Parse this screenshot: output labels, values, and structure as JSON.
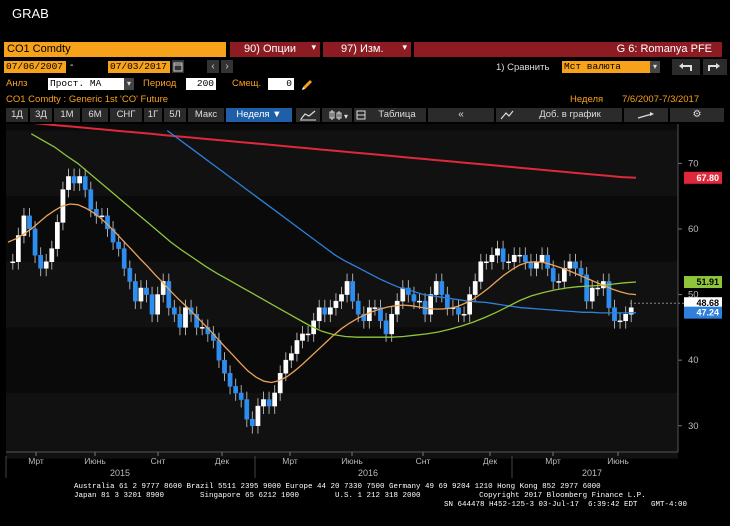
{
  "window": {
    "title": "GRAB"
  },
  "header": {
    "security": "CO1 Comdty",
    "options_menu": "90) Опции",
    "edit_menu": "97) Изм.",
    "page_label": "G 6: Romanya PFE"
  },
  "controls": {
    "date_from": "07/06/2007",
    "date_sep": "-",
    "date_to": "07/03/2017",
    "compare_label": "1) Сравнить",
    "currency_value": "Мст валюта",
    "study_label": "Анлз",
    "study_value": "Прост. MA",
    "period_label": "Период",
    "period_value": "200",
    "shift_label": "Смещ.",
    "shift_value": "0"
  },
  "subheader": {
    "description": "CO1 Comdty : Generic 1st 'CO' Future",
    "frequency": "Неделя",
    "range": "7/6/2007-7/3/2017"
  },
  "toolbar": {
    "periods": [
      "1Д",
      "3Д",
      "1М",
      "6М",
      "СНГ",
      "1Г",
      "5Л",
      "Макс"
    ],
    "frequency_select": "Неделя ▼",
    "table_label": "Таблица",
    "add_to_chart": "Доб. в график"
  },
  "colors": {
    "amber": "#f7a21b",
    "menu_red": "#8c1b22",
    "ma200": "#e0283c",
    "ma100": "#2f7fdc",
    "ma50": "#8fc53a",
    "ma20": "#e9a35a",
    "candle": "#2d8ef0",
    "price_tag": "#ffffff"
  },
  "chart_data": {
    "type": "candlestick",
    "y_ticks": [
      30,
      40,
      50,
      60,
      70
    ],
    "ylim": [
      26,
      76
    ],
    "x_ticks": [
      "Мрт",
      "Июнь",
      "Снт",
      "Дек",
      "Мрт",
      "Июнь",
      "Снт",
      "Дек",
      "Мрт",
      "Июнь"
    ],
    "year_labels": [
      "2015",
      "2016",
      "2017"
    ],
    "last_values": [
      {
        "label": "67.80",
        "color": "#e0283c"
      },
      {
        "label": "51.91",
        "color": "#8fc53a"
      },
      {
        "label": "48.68",
        "color": "#ffffff"
      },
      {
        "label": "47.24",
        "color": "#2f7fdc"
      }
    ],
    "close": [
      55,
      59,
      62,
      60,
      56,
      54,
      55,
      57,
      61,
      66,
      68,
      67,
      68,
      66,
      63,
      62,
      62,
      60,
      58,
      57,
      54,
      52,
      49,
      51,
      50,
      47,
      50,
      52,
      48,
      47,
      45,
      48,
      47,
      45,
      45,
      44,
      43,
      40,
      38,
      36,
      35,
      34,
      31,
      30,
      33,
      34,
      33,
      35,
      38,
      40,
      41,
      43,
      44,
      44,
      46,
      48,
      47,
      48,
      49,
      50,
      52,
      49,
      47,
      46,
      48,
      48,
      46,
      44,
      47,
      49,
      51,
      50,
      49,
      49,
      47,
      50,
      52,
      50,
      48,
      48,
      47,
      47,
      50,
      52,
      55,
      55,
      56,
      57,
      55,
      55,
      56,
      56,
      55,
      54,
      55,
      56,
      54,
      52,
      52,
      54,
      55,
      54,
      53,
      49,
      51,
      51,
      52,
      48,
      46,
      46,
      47,
      48
    ],
    "ma200": [
      76.5,
      76.3,
      76.1,
      75.9,
      75.7,
      75.5,
      75.3,
      75.1,
      74.9,
      74.7,
      74.5,
      74.3,
      74.1,
      73.9,
      73.7,
      73.5,
      73.3,
      73.1,
      72.9,
      72.7,
      72.5,
      72.3,
      72.1,
      71.9,
      71.7,
      71.5,
      71.3,
      71.1,
      70.9,
      70.7,
      70.5,
      70.3,
      70.1,
      69.9,
      69.7,
      69.5,
      69.3,
      69.1,
      68.9,
      68.7,
      68.5,
      68.3,
      68.1,
      67.9,
      67.8
    ],
    "ma100": [
      null,
      null,
      null,
      null,
      null,
      null,
      null,
      null,
      null,
      null,
      null,
      null,
      null,
      null,
      null,
      null,
      null,
      null,
      75,
      74,
      73,
      72,
      71,
      70,
      69,
      68,
      67,
      66,
      65,
      64,
      63,
      62,
      61,
      60,
      59,
      58,
      57,
      56,
      55.2,
      54.5,
      53.8,
      53.1,
      52.4,
      51.8,
      51.2,
      50.8,
      50.4,
      50,
      49.8,
      49.6,
      49.4,
      49.2,
      49.0,
      48.9,
      48.8,
      48.6,
      48.4,
      48.2,
      48.0,
      47.9,
      47.8,
      47.7,
      47.6,
      47.5,
      47.4,
      47.3,
      47.3,
      47.2,
      47.2,
      47.2,
      47.2,
      47.24
    ],
    "ma50": [
      null,
      null,
      74.5,
      73.5,
      72.5,
      71.2,
      70,
      68.5,
      67,
      65.5,
      64,
      62.5,
      61,
      59.5,
      58,
      56.7,
      55.5,
      54.3,
      53.2,
      52.2,
      51.2,
      50.2,
      49.2,
      48.2,
      47.2,
      46.2,
      45.2,
      44.4,
      43.9,
      43.6,
      43.5,
      43.5,
      43.5,
      43.5,
      43.6,
      43.8,
      44.0,
      44.3,
      44.7,
      45.2,
      45.8,
      46.5,
      47.3,
      48.2,
      49.1,
      49.8,
      50.3,
      50.7,
      51.0,
      51.2,
      51.3,
      51.4,
      51.6,
      51.8,
      51.91
    ],
    "ma20": [
      58,
      58.5,
      59.2,
      60.0,
      61,
      62,
      62.8,
      63.5,
      63.8,
      63.7,
      63.2,
      62.5,
      61.6,
      60.5,
      59.3,
      58,
      56.8,
      55.5,
      54.3,
      53,
      51.8,
      50.5,
      49.3,
      48.2,
      47.0,
      45.8,
      44.6,
      43.3,
      42,
      40.8,
      39.5,
      38.3,
      37.4,
      36.8,
      36.6,
      36.9,
      37.5,
      38.4,
      39.4,
      40.5,
      41.6,
      42.7,
      43.8,
      44.8,
      45.6,
      46.3,
      46.9,
      47.4,
      47.8,
      48.1,
      48.3,
      48.4,
      48.3,
      48.1,
      47.9,
      47.8,
      47.8,
      47.9,
      48.2,
      48.7,
      49.3,
      50.1,
      51.0,
      52.0,
      53.0,
      53.8,
      54.5,
      54.9,
      55.0,
      54.9,
      54.6,
      54.2,
      53.8,
      53.3,
      52.8,
      52.3,
      51.8,
      51.3,
      50.8,
      50.4,
      50.1,
      50.0
    ]
  },
  "footer": {
    "line1": "Australia 61 2 9777 8600 Brazil 5511 2395 9000 Europe 44 20 7330 7500 Germany 49 69 9204 1210 Hong Kong 852 2977 6000",
    "line2": "Japan 81 3 3201 8900        Singapore 65 6212 1000        U.S. 1 212 318 2000             Copyright 2017 Bloomberg Finance L.P.",
    "line3": "SN 644478 H452-125-3 03-Jul-17  6:39:42 EDT   GMT-4:00"
  }
}
